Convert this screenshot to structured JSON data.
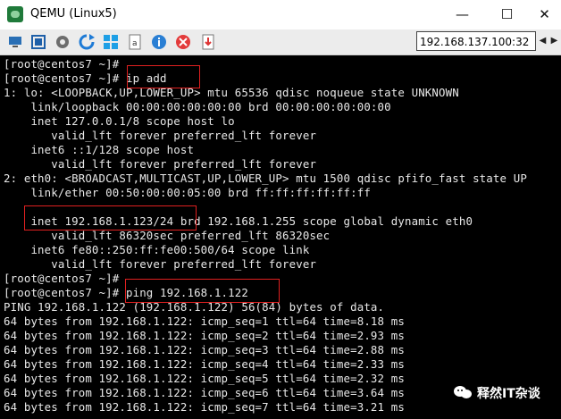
{
  "window": {
    "title": "QEMU (Linux5)",
    "minimize": "—",
    "maximize": "☐",
    "close": "✕"
  },
  "toolbar": {
    "icons": [
      "monitor-icon",
      "fullscreen-icon",
      "settings-gear-icon",
      "refresh-icon",
      "windows-logo-icon",
      "text-document-icon",
      "info-icon",
      "stop-icon",
      "download-icon"
    ],
    "address_value": "192.168.137.100:32",
    "scroll_left": "◀",
    "scroll_right": "▶"
  },
  "terminal": {
    "lines": [
      "[root@centos7 ~]#",
      "[root@centos7 ~]# ip add",
      "1: lo: <LOOPBACK,UP,LOWER_UP> mtu 65536 qdisc noqueue state UNKNOWN",
      "    link/loopback 00:00:00:00:00:00 brd 00:00:00:00:00:00",
      "    inet 127.0.0.1/8 scope host lo",
      "       valid_lft forever preferred_lft forever",
      "    inet6 ::1/128 scope host",
      "       valid_lft forever preferred_lft forever",
      "2: eth0: <BROADCAST,MULTICAST,UP,LOWER_UP> mtu 1500 qdisc pfifo_fast state UP",
      "    link/ether 00:50:00:00:05:00 brd ff:ff:ff:ff:ff:ff",
      "",
      "    inet 192.168.1.123/24 brd 192.168.1.255 scope global dynamic eth0",
      "       valid_lft 86320sec preferred_lft 86320sec",
      "    inet6 fe80::250:ff:fe00:500/64 scope link",
      "       valid_lft forever preferred_lft forever",
      "[root@centos7 ~]#",
      "[root@centos7 ~]# ping 192.168.1.122",
      "PING 192.168.1.122 (192.168.1.122) 56(84) bytes of data.",
      "64 bytes from 192.168.1.122: icmp_seq=1 ttl=64 time=8.18 ms",
      "64 bytes from 192.168.1.122: icmp_seq=2 ttl=64 time=2.93 ms",
      "64 bytes from 192.168.1.122: icmp_seq=3 ttl=64 time=2.88 ms",
      "64 bytes from 192.168.1.122: icmp_seq=4 ttl=64 time=2.33 ms",
      "64 bytes from 192.168.1.122: icmp_seq=5 ttl=64 time=2.32 ms",
      "64 bytes from 192.168.1.122: icmp_seq=6 ttl=64 time=3.64 ms",
      "64 bytes from 192.168.1.122: icmp_seq=7 ttl=64 time=3.21 ms"
    ],
    "text_color": "#e8e8e8",
    "background": "#000000",
    "highlight_color": "#e02020"
  },
  "watermark": {
    "text": "释然IT杂谈"
  }
}
